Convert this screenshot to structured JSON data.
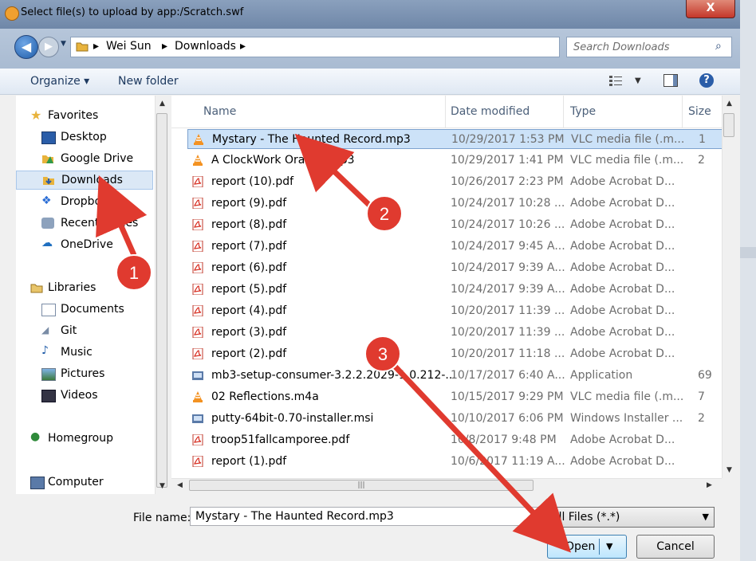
{
  "window": {
    "title": "Select file(s) to upload by app:/Scratch.swf",
    "close_label": "X"
  },
  "address": {
    "crumbs": [
      "Wei Sun",
      "Downloads"
    ],
    "search_placeholder": "Search Downloads"
  },
  "toolbar": {
    "organize": "Organize ▾",
    "new_folder": "New folder"
  },
  "nav": {
    "items": [
      {
        "label": "Favorites"
      },
      {
        "label": "Desktop"
      },
      {
        "label": "Google Drive"
      },
      {
        "label": "Downloads"
      },
      {
        "label": "Dropbox"
      },
      {
        "label": "Recent Places"
      },
      {
        "label": "OneDrive"
      },
      {
        "label": "Libraries"
      },
      {
        "label": "Documents"
      },
      {
        "label": "Git"
      },
      {
        "label": "Music"
      },
      {
        "label": "Pictures"
      },
      {
        "label": "Videos"
      },
      {
        "label": "Homegroup"
      },
      {
        "label": "Computer"
      }
    ]
  },
  "columns": {
    "name": "Name",
    "date": "Date modified",
    "type": "Type",
    "size": "Size"
  },
  "files": [
    {
      "name": "Mystary - The Haunted Record.mp3",
      "date": "10/29/2017 1:53 PM",
      "type": "VLC media file (.m...",
      "size": "1",
      "icon": "vlc"
    },
    {
      "name": "A ClockWork Orange.mp3",
      "date": "10/29/2017 1:41 PM",
      "type": "VLC media file (.m...",
      "size": "2",
      "icon": "vlc"
    },
    {
      "name": "report (10).pdf",
      "date": "10/26/2017 2:23 PM",
      "type": "Adobe Acrobat D...",
      "size": "",
      "icon": "pdf"
    },
    {
      "name": "report (9).pdf",
      "date": "10/24/2017 10:28 ...",
      "type": "Adobe Acrobat D...",
      "size": "",
      "icon": "pdf"
    },
    {
      "name": "report (8).pdf",
      "date": "10/24/2017 10:26 ...",
      "type": "Adobe Acrobat D...",
      "size": "",
      "icon": "pdf"
    },
    {
      "name": "report (7).pdf",
      "date": "10/24/2017 9:45 A...",
      "type": "Adobe Acrobat D...",
      "size": "",
      "icon": "pdf"
    },
    {
      "name": "report (6).pdf",
      "date": "10/24/2017 9:39 A...",
      "type": "Adobe Acrobat D...",
      "size": "",
      "icon": "pdf"
    },
    {
      "name": "report (5).pdf",
      "date": "10/24/2017 9:39 A...",
      "type": "Adobe Acrobat D...",
      "size": "",
      "icon": "pdf"
    },
    {
      "name": "report (4).pdf",
      "date": "10/20/2017 11:39 ...",
      "type": "Adobe Acrobat D...",
      "size": "",
      "icon": "pdf"
    },
    {
      "name": "report (3).pdf",
      "date": "10/20/2017 11:39 ...",
      "type": "Adobe Acrobat D...",
      "size": "",
      "icon": "pdf"
    },
    {
      "name": "report (2).pdf",
      "date": "10/20/2017 11:18 ...",
      "type": "Adobe Acrobat D...",
      "size": "",
      "icon": "pdf"
    },
    {
      "name": "mb3-setup-consumer-3.2.2.2029-1.0.212-...",
      "date": "10/17/2017 6:40 A...",
      "type": "Application",
      "size": "69",
      "icon": "app"
    },
    {
      "name": "02 Reflections.m4a",
      "date": "10/15/2017 9:29 PM",
      "type": "VLC media file (.m...",
      "size": "7",
      "icon": "vlc"
    },
    {
      "name": "putty-64bit-0.70-installer.msi",
      "date": "10/10/2017 6:06 PM",
      "type": "Windows Installer ...",
      "size": "2",
      "icon": "app"
    },
    {
      "name": "troop51fallcamporee.pdf",
      "date": "10/8/2017 9:48 PM",
      "type": "Adobe Acrobat D...",
      "size": "",
      "icon": "pdf"
    },
    {
      "name": "report (1).pdf",
      "date": "10/6/2017 11:19 A...",
      "type": "Adobe Acrobat D...",
      "size": "",
      "icon": "pdf"
    }
  ],
  "bottom": {
    "file_name_label": "File name:",
    "file_name_value": "Mystary - The Haunted Record.mp3",
    "file_type": "All Files (*.*)",
    "open": "Open",
    "cancel": "Cancel"
  },
  "annotations": [
    "1",
    "2",
    "3"
  ],
  "colors": {
    "arrow": "#e03a2f",
    "selection": "#cce2f8",
    "accent": "#1f5ca8"
  }
}
